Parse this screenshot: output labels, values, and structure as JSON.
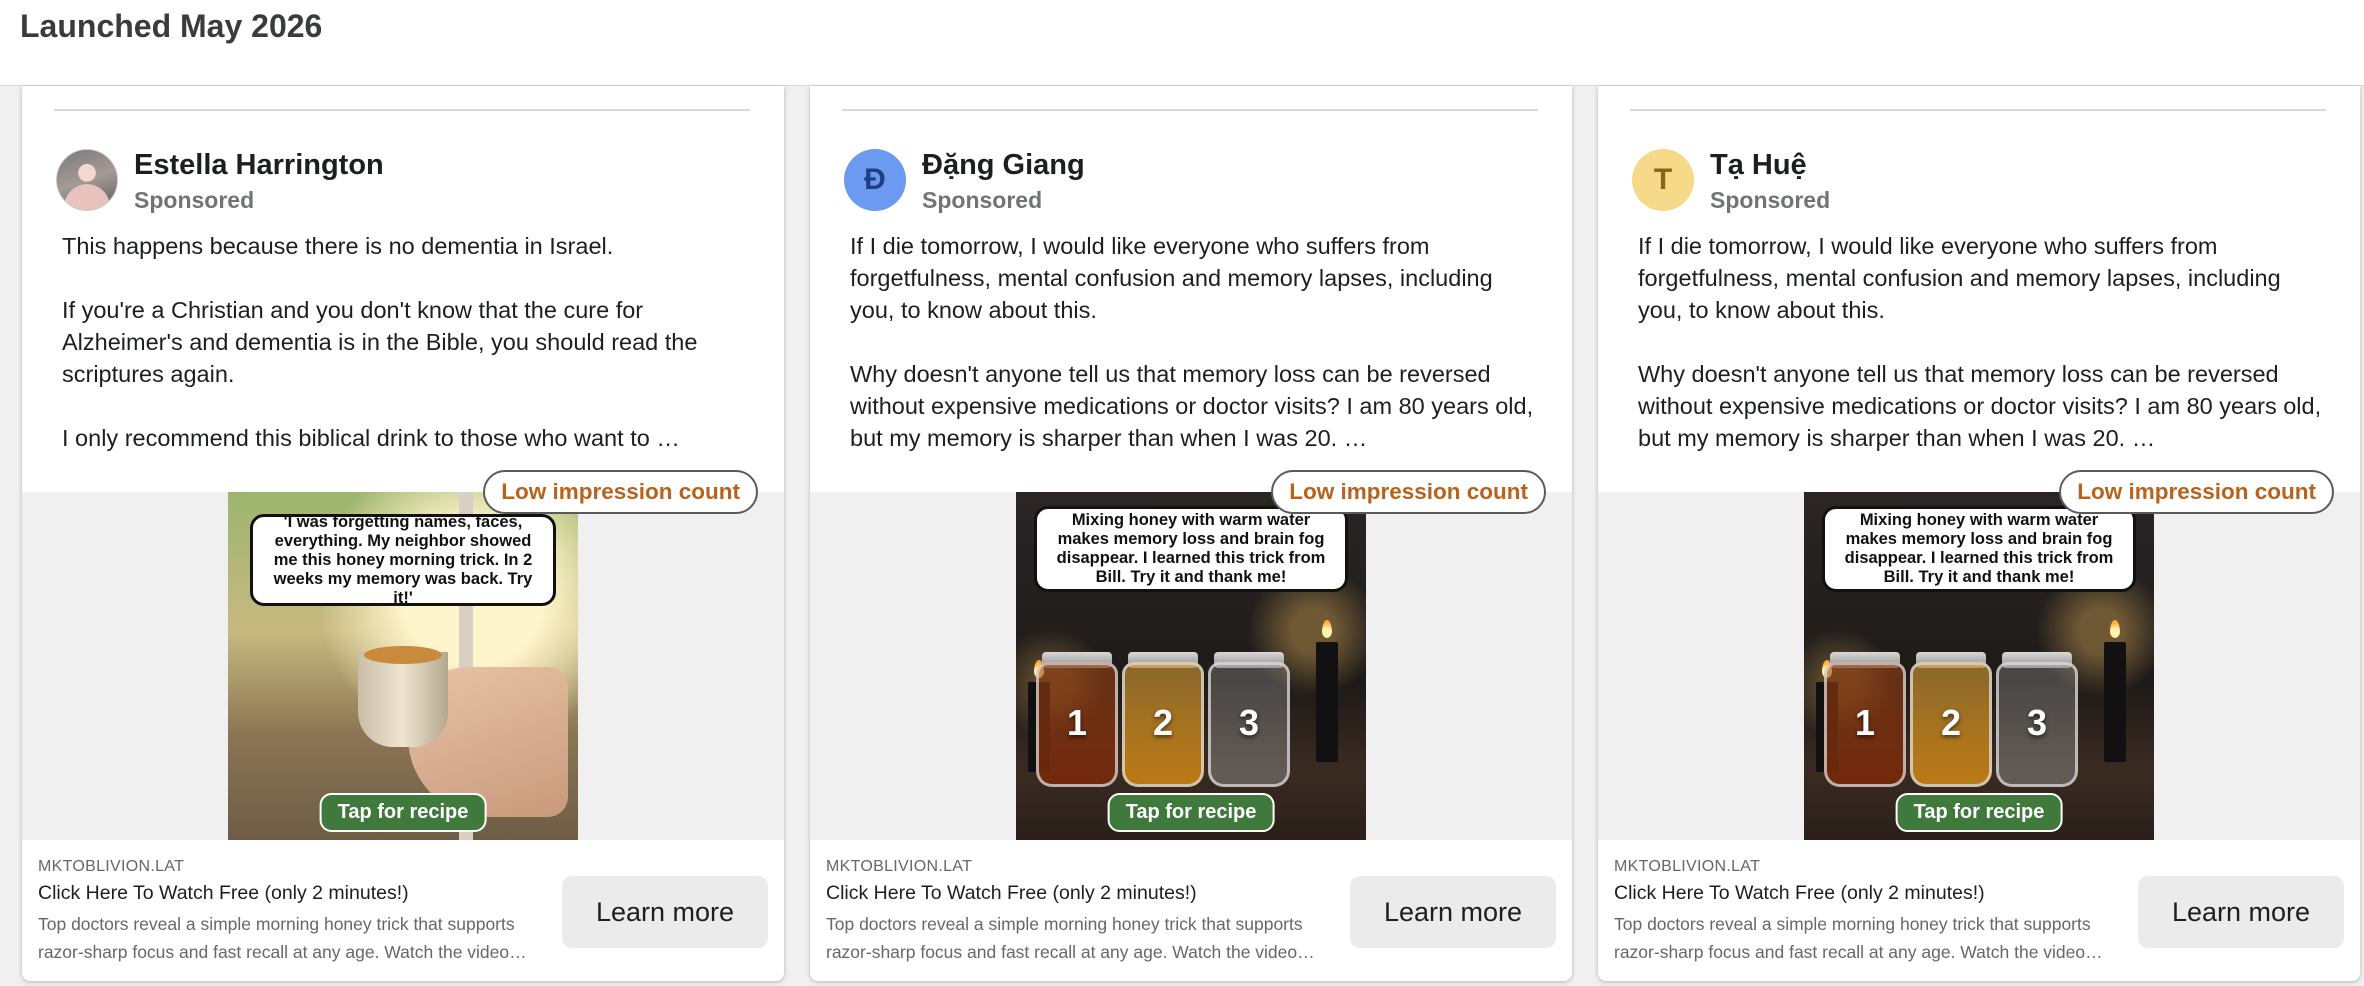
{
  "page": {
    "title": "Launched May 2026"
  },
  "badge_label": "Low impression count",
  "cards": [
    {
      "advertiser": "Estella Harrington",
      "avatar_letter": "",
      "sponsored": "Sponsored",
      "body": [
        "This happens because there is no dementia in Israel.",
        "If you're a Christian and you don't know that the cure for Alzheimer's and dementia is in the Bible, you should read the scriptures again.",
        "I only recommend this biblical drink to those who want to …"
      ],
      "image_caption": "'I was forgetting names, faces, everything. My neighbor showed me this honey morning trick. In 2 weeks my memory was back. Try it!'",
      "image_button": "Tap for recipe",
      "domain": "MKTOBLIVION.LAT",
      "headline": "Click Here To Watch Free (only 2 minutes!)",
      "description": "Top doctors reveal a simple morning honey trick that supports razor-sharp focus and fast recall at any age. Watch the video…",
      "cta": "Learn more"
    },
    {
      "advertiser": "Đặng Giang",
      "avatar_letter": "Đ",
      "avatar_bg": "#6b9af0",
      "avatar_fg": "#1f3f85",
      "sponsored": "Sponsored",
      "body": [
        "If I die tomorrow, I would like everyone who suffers from forgetfulness, mental confusion and memory lapses, including you, to know about this.",
        "Why doesn't anyone tell us that memory loss can be reversed without expensive medications or doctor visits? I am 80 years old, but my memory is sharper than when I was 20. …"
      ],
      "image_caption": "Mixing honey with warm water makes memory loss and brain fog disappear. I learned this trick from Bill. Try it and thank me!",
      "jar_numbers": [
        "1",
        "2",
        "3"
      ],
      "image_button": "Tap for recipe",
      "domain": "MKTOBLIVION.LAT",
      "headline": "Click Here To Watch Free (only 2 minutes!)",
      "description": "Top doctors reveal a simple morning honey trick that supports razor-sharp focus and fast recall at any age. Watch the video…",
      "cta": "Learn more"
    },
    {
      "advertiser": "Tạ Huệ",
      "avatar_letter": "T",
      "avatar_bg": "#f7d98a",
      "avatar_fg": "#8a6417",
      "sponsored": "Sponsored",
      "body": [
        "If I die tomorrow, I would like everyone who suffers from forgetfulness, mental confusion and memory lapses, including you, to know about this.",
        "Why doesn't anyone tell us that memory loss can be reversed without expensive medications or doctor visits? I am 80 years old, but my memory is sharper than when I was 20. …"
      ],
      "image_caption": "Mixing honey with warm water makes memory loss and brain fog disappear. I learned this trick from Bill. Try it and thank me!",
      "jar_numbers": [
        "1",
        "2",
        "3"
      ],
      "image_button": "Tap for recipe",
      "domain": "MKTOBLIVION.LAT",
      "headline": "Click Here To Watch Free (only 2 minutes!)",
      "description": "Top doctors reveal a simple morning honey trick that supports razor-sharp focus and fast recall at any age. Watch the video…",
      "cta": "Learn more"
    }
  ]
}
